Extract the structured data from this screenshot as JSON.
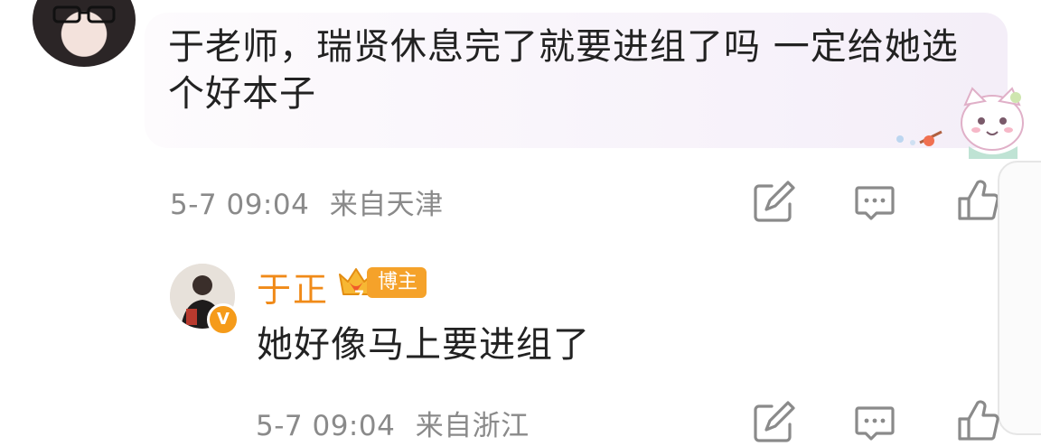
{
  "comment": {
    "text": "于老师，瑞贤休息完了就要进组了吗 一定给她选个好本子",
    "time": "5-7 09:04",
    "location": "来自天津"
  },
  "reply": {
    "author": "于正",
    "badge": "博主",
    "verified_mark": "V",
    "level": "7",
    "text": "她好像马上要进组了",
    "time": "5-7 09:04",
    "location": "来自浙江"
  },
  "icons": {
    "share": "share-icon",
    "comment": "comment-icon",
    "like": "like-icon"
  },
  "colors": {
    "author_name": "#f08a18",
    "badge_bg": "#f5a22a",
    "meta_text": "#8a8a8a"
  }
}
